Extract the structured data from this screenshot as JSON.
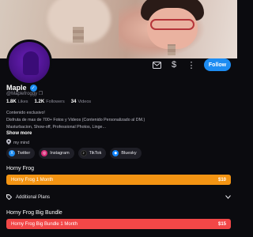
{
  "profile": {
    "name": "Maple",
    "handle": "@Maplefroggy",
    "stats": [
      {
        "value": "1.8K",
        "label": "Likes"
      },
      {
        "value": "1.2K",
        "label": "Followers"
      },
      {
        "value": "34",
        "label": "Videos"
      }
    ],
    "bio_lines": [
      "Contenido exclusivo!",
      "Disfruta de mas de 700+ Fotos y Videos (Contenido Personalizado al DM.)",
      "Masturbacion, Show-off, Professional Photos, Linge..."
    ],
    "show_more": "Show more",
    "location": "my mind"
  },
  "actions": {
    "follow_label": "Follow"
  },
  "socials": [
    {
      "label": "Twitter",
      "icon": "x-icon",
      "color": "#1d8cf2"
    },
    {
      "label": "Instagram",
      "icon": "instagram-icon",
      "color": "#d62976"
    },
    {
      "label": "TikTok",
      "icon": "tiktok-icon",
      "color": "#111111"
    },
    {
      "label": "Bluesky",
      "icon": "bluesky-icon",
      "color": "#1185fe"
    }
  ],
  "plans": {
    "section1_title": "Horny Frog",
    "plan1": {
      "name": "Horny Frog 1 Month",
      "price": "$10",
      "color": "#f39413"
    },
    "additional_label": "Additional Plans",
    "section2_title": "Horny Frog Big Bundle",
    "plan2": {
      "name": "Horny Frog Big Bundle 1 Month",
      "price": "$15",
      "color": "#f24747"
    }
  },
  "colors": {
    "accent": "#1d8cf2",
    "background": "#0b0b0f"
  }
}
